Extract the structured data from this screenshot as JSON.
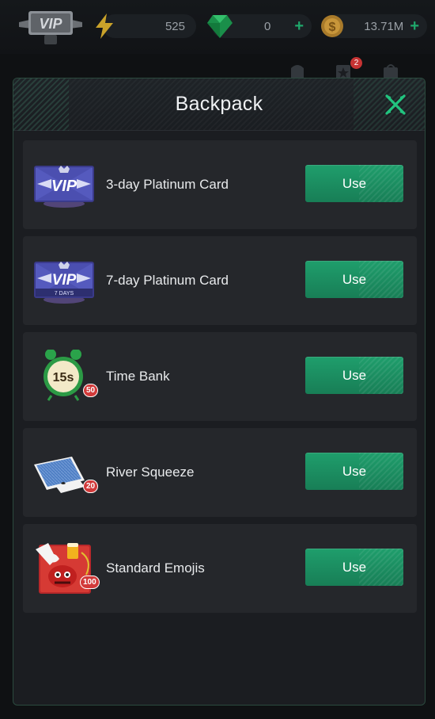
{
  "topbar": {
    "vip_text": "VIP",
    "energy": "525",
    "gems": "0",
    "coins": "13.71M",
    "plus": "+",
    "notification_count": "2",
    "colors": {
      "accent_green": "#1fa86b",
      "badge_red": "#c63333"
    }
  },
  "modal": {
    "title": "Backpack",
    "close_icon": "close-x-icon",
    "items": [
      {
        "name": "3-day Platinum Card",
        "button": "Use",
        "icon": "vip-card-icon",
        "card_text": "VIP"
      },
      {
        "name": "7-day Platinum Card",
        "button": "Use",
        "icon": "vip-card-7days-icon",
        "card_text": "VIP",
        "card_sub": "7 DAYS"
      },
      {
        "name": "Time Bank",
        "button": "Use",
        "icon": "alarm-clock-icon",
        "clock_text": "15s",
        "count": "50"
      },
      {
        "name": "River Squeeze",
        "button": "Use",
        "icon": "playing-card-icon",
        "count": "20"
      },
      {
        "name": "Standard Emojis",
        "button": "Use",
        "icon": "emoji-pack-icon",
        "count": "100"
      }
    ]
  }
}
